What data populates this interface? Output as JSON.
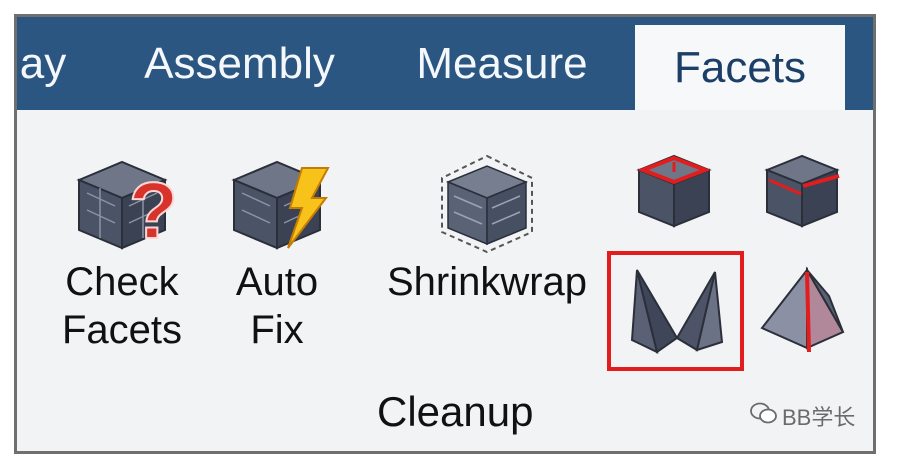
{
  "tabs": [
    {
      "label": "ay",
      "active": false
    },
    {
      "label": "Assembly",
      "active": false
    },
    {
      "label": "Measure",
      "active": false
    },
    {
      "label": "Facets",
      "active": true
    }
  ],
  "tools": {
    "check_facets": "Check\nFacets",
    "auto_fix": "Auto\nFix",
    "shrinkwrap": "Shrinkwrap"
  },
  "group": {
    "label": "Cleanup"
  },
  "watermark": {
    "text": "BB学长"
  },
  "colors": {
    "tab_bar": "#2b5682",
    "ribbon_bg": "#f2f3f5",
    "highlight_box": "#e31d1d"
  }
}
